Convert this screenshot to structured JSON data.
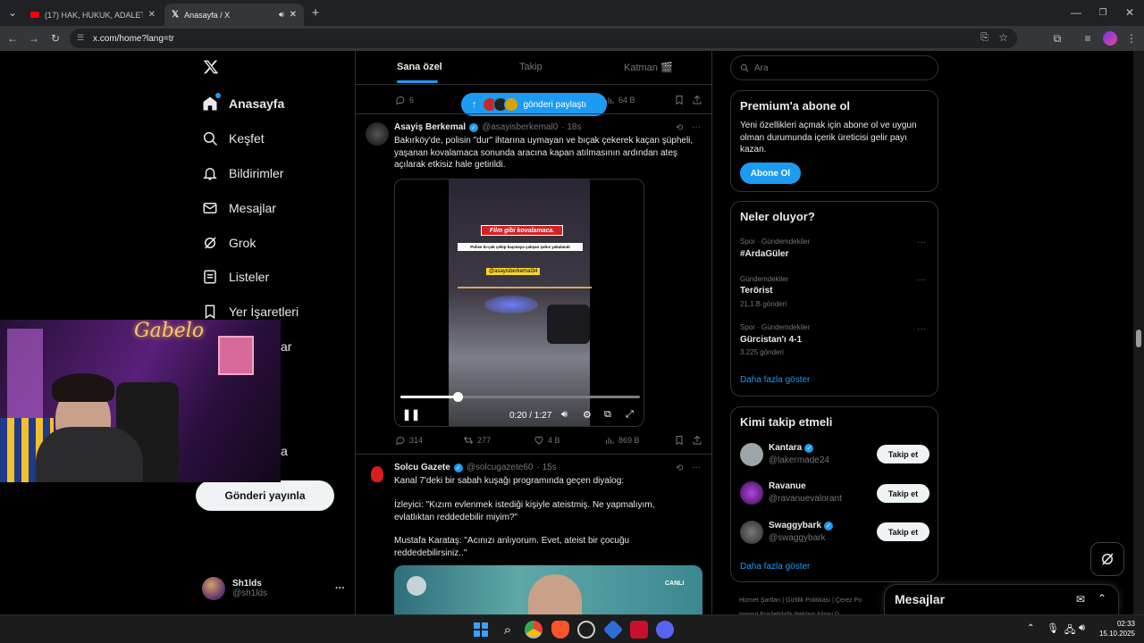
{
  "browser": {
    "tabs": [
      {
        "title": "(17) HAK, HUKUK, ADALET | Ma"
      },
      {
        "title": "Anasayfa / X"
      }
    ],
    "url": "x.com/home?lang=tr"
  },
  "nav": {
    "items": [
      {
        "label": "Anasayfa",
        "icon": "home-icon"
      },
      {
        "label": "Keşfet",
        "icon": "search-icon"
      },
      {
        "label": "Bildirimler",
        "icon": "bell-icon"
      },
      {
        "label": "Mesajlar",
        "icon": "mail-icon"
      },
      {
        "label": "Grok",
        "icon": "grok-icon"
      },
      {
        "label": "Listeler",
        "icon": "list-icon"
      },
      {
        "label": "Yer İşaretleri",
        "icon": "bookmark-icon"
      }
    ],
    "partial_labels": [
      "ar",
      "a"
    ],
    "post_button": "Gönderi yayınla",
    "account": {
      "name": "Sh1lds",
      "handle": "@sh1lds",
      "more": "···"
    }
  },
  "feed": {
    "tabs": [
      "Sana özel",
      "Takip",
      "Katman 🎬"
    ],
    "share_pill": "gönderi paylaştı",
    "prev_actions": {
      "replies": "6",
      "views": "64 B"
    },
    "tweet1": {
      "name": "Asayiş Berkemal",
      "handle": "@asayisberkemal0",
      "time": "· 18s",
      "text": "Bakırköy'de, polisin \"dur\" ihtarına uymayan ve bıçak çekerek kaçan şüpheli, yaşanan kovalamaca sonunda aracına kapan atılmasının ardından ateş açılarak etkisiz hale getirildi.",
      "video": {
        "caption_red": "Film gibi kovalamaca.",
        "caption_white": "Polise bı-çak çekip kaçmaya çalışan şahıs yakalandı",
        "watermark": "@asayisberkemal34",
        "time": "0:20 / 1:27",
        "progress": 0.24
      },
      "actions": {
        "replies": "314",
        "reposts": "277",
        "likes": "4 B",
        "views": "869 B"
      }
    },
    "tweet2": {
      "name": "Solcu Gazete",
      "handle": "@solcugazete60",
      "time": "· 15s",
      "text1": "Kanal 7'deki bir sabah kuşağı programında geçen diyalog:",
      "text2": "İzleyici: \"Kızım evlenmek istediği kişiyle ateistmiş. Ne yapmalıyım, evlatlıktan reddedebilir miyim?\"",
      "text3": "Mustafa Karataş: \"Acınızı anlıyorum. Evet, ateist bir çocuğu reddedebilirsiniz..\"",
      "media_badge": "CANLI"
    }
  },
  "sidebar": {
    "search_placeholder": "Ara",
    "premium": {
      "title": "Premium'a abone ol",
      "text": "Yeni özellikleri açmak için abone ol ve uygun olman durumunda içerik üreticisi gelir payı kazan.",
      "button": "Abone Ol"
    },
    "trends": {
      "title": "Neler oluyor?",
      "items": [
        {
          "meta": "Spor · Gündemdekiler",
          "name": "#ArdaGüler",
          "count": ""
        },
        {
          "meta": "Gündemdekiler",
          "name": "Terörist",
          "count": "21,1 B gönderi"
        },
        {
          "meta": "Spor · Gündemdekiler",
          "name": "Gürcistan'ı 4-1",
          "count": "3.225 gönderi"
        }
      ],
      "more": "Daha fazla göster"
    },
    "follow": {
      "title": "Kimi takip etmeli",
      "items": [
        {
          "name": "Kantara",
          "handle": "@lakermade24",
          "verified": true
        },
        {
          "name": "Ravanue",
          "handle": "@ravanuevalorant",
          "verified": false
        },
        {
          "name": "Swaggybark",
          "handle": "@swaggybark",
          "verified": true
        }
      ],
      "button": "Takip et",
      "more": "Daha fazla göster"
    },
    "footer": [
      "Hizmet Şartları",
      "Gizlilik Politikası",
      "Çerez Po",
      "Imprint",
      "Erişilebilirlik",
      "Reklam bilgisi",
      "D"
    ]
  },
  "messages_drawer": {
    "title": "Mesajlar"
  },
  "webcam": {
    "neon_text": "Gabelo"
  },
  "taskbar": {
    "time": "02:33",
    "date": "15.10.2025"
  },
  "colors": {
    "accent": "#1d9bf0",
    "bg": "#000000",
    "border": "#2f3336",
    "muted": "#71767b"
  }
}
